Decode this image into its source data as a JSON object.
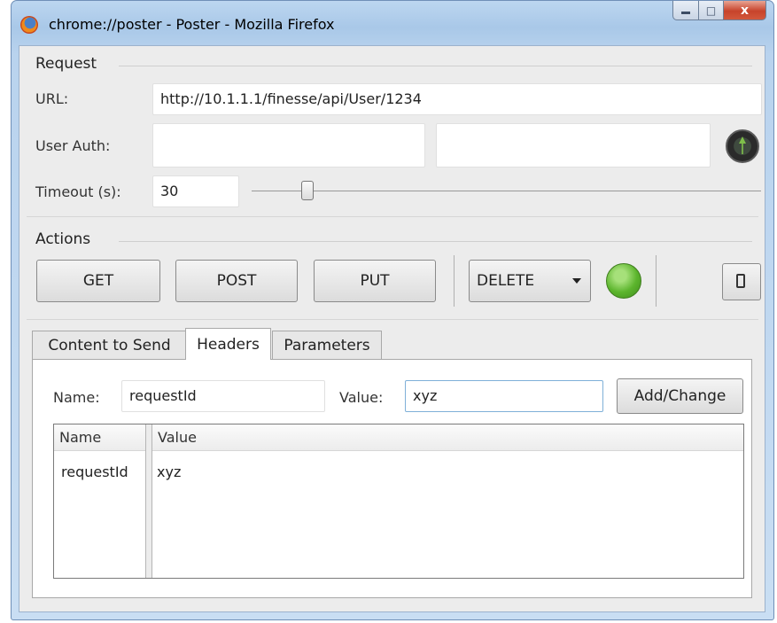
{
  "window": {
    "title": "chrome://poster - Poster - Mozilla Firefox",
    "close_glyph": "x",
    "max_glyph": "□"
  },
  "request": {
    "group_title": "Request",
    "url_label": "URL:",
    "url_value": "http://10.1.1.1/finesse/api/User/1234",
    "auth_label": "User Auth:",
    "auth_user": "",
    "auth_password": "",
    "timeout_label": "Timeout (s):",
    "timeout_value": "30",
    "timeout_slider_fraction": 0.1
  },
  "actions": {
    "group_title": "Actions",
    "get": "GET",
    "post": "POST",
    "put": "PUT",
    "delete": "DELETE",
    "status_color": "#5cb52d"
  },
  "tabs": [
    {
      "label": "Content to Send",
      "active": false
    },
    {
      "label": "Headers",
      "active": true
    },
    {
      "label": "Parameters",
      "active": false
    }
  ],
  "headers": {
    "name_label": "Name:",
    "name_value": "requestId",
    "value_label": "Value:",
    "value_value": "xyz",
    "add_button": "Add/Change",
    "columns": [
      "Name",
      "Value"
    ],
    "rows": [
      {
        "name": "requestId",
        "value": "xyz"
      }
    ]
  }
}
